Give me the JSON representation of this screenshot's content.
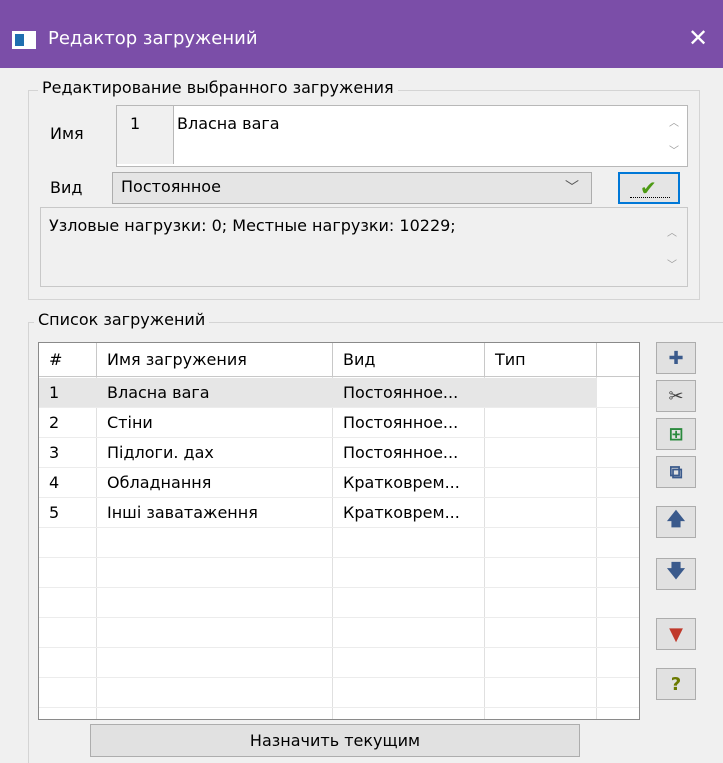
{
  "window": {
    "title": "Редактор загружений",
    "close_label": "✕"
  },
  "edit_group": {
    "legend": "Редактирование выбранного загружения",
    "name_label": "Имя",
    "load_number": "1",
    "load_name": "Власна вага",
    "type_label": "Вид",
    "type_value": "Постоянное",
    "info": "Узловые нагрузки: 0; Местные нагрузки: 10229;"
  },
  "list_group": {
    "legend": "Список загружений",
    "columns": [
      "#",
      "Имя загружения",
      "Вид",
      "Тип"
    ],
    "rows": [
      [
        "1",
        "Власна вага",
        "Постоянное...",
        ""
      ],
      [
        "2",
        "Стіни",
        "Постоянное...",
        ""
      ],
      [
        "3",
        "Підлоги. дах",
        "Постоянное...",
        ""
      ],
      [
        "4",
        "Обладнання",
        "Кратковрем...",
        ""
      ],
      [
        "5",
        "Інші заватаження",
        "Кратковрем...",
        ""
      ]
    ]
  },
  "side_buttons": [
    {
      "name": "add-load-button",
      "icon": "plus-icon",
      "glyph": "✚",
      "color": "#3a5a8c"
    },
    {
      "name": "cut-load-button",
      "icon": "scissors-icon",
      "glyph": "✂",
      "color": "#444444"
    },
    {
      "name": "insert-load-button",
      "icon": "insert-table-icon",
      "glyph": "⊞",
      "color": "#2b8a3e"
    },
    {
      "name": "copy-load-button",
      "icon": "copy-icon",
      "glyph": "⧉",
      "color": "#3a5a8c"
    },
    {
      "name": "move-up-button",
      "icon": "arrow-up-icon",
      "glyph": "🡅",
      "color": "#3a5a8c"
    },
    {
      "name": "move-down-button",
      "icon": "arrow-down-icon",
      "glyph": "🡇",
      "color": "#3a5a8c"
    },
    {
      "name": "filter-button",
      "icon": "filter-icon",
      "glyph": "▼",
      "color": "#c0392b"
    },
    {
      "name": "help-button",
      "icon": "help-icon",
      "glyph": "?",
      "color": "#6b7a00"
    }
  ],
  "assign_button": "Назначить текущим",
  "colors": {
    "titlebar": "#7b4ea8",
    "row_selected": "#e6e6e6",
    "focus_border": "#0078d7"
  }
}
